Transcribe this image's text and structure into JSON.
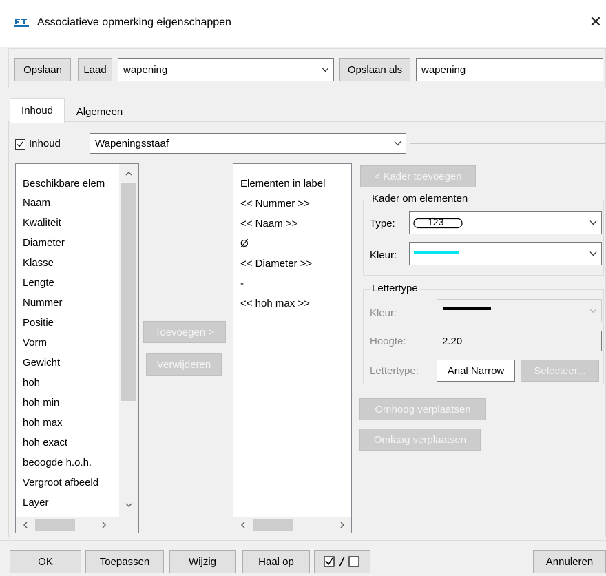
{
  "window": {
    "title": "Associatieve opmerking eigenschappen"
  },
  "toolbar": {
    "save_label": "Opslaan",
    "load_label": "Laad",
    "preset_value": "wapening",
    "save_as_label": "Opslaan als",
    "save_as_value": "wapening"
  },
  "tabs": [
    {
      "label": "Inhoud"
    },
    {
      "label": "Algemeen"
    }
  ],
  "content": {
    "checkbox_label": "Inhoud",
    "type_value": "Wapeningsstaaf"
  },
  "available": {
    "header": "Beschikbare elem",
    "items": [
      "Naam",
      "Kwaliteit",
      "Diameter",
      "Klasse",
      "Lengte",
      "Nummer",
      "Positie",
      "Vorm",
      "Gewicht",
      "hoh",
      "hoh min",
      "hoh max",
      "hoh exact",
      "beoogde h.o.h.",
      "Vergroot afbeeld",
      "Layer"
    ]
  },
  "middle": {
    "add_label": "Toevoegen >",
    "remove_label": "Verwijderen"
  },
  "label_elements": {
    "header": "Elementen in label",
    "items": [
      "<< Nummer >>",
      "<< Naam >>",
      "Ø",
      "<< Diameter >>",
      "-",
      "<< hoh max >>"
    ]
  },
  "frame": {
    "add_frame_label": "< Kader toevoegen",
    "group_title": "Kader om elementen",
    "type_label": "Type:",
    "type_value": "123",
    "color_label": "Kleur:",
    "color_value": "#00e5ee"
  },
  "font": {
    "group_title": "Lettertype",
    "color_label": "Kleur:",
    "color_value": "#000000",
    "height_label": "Hoogte:",
    "height_value": "2.20",
    "font_label": "Lettertype:",
    "font_value": "Arial Narrow",
    "select_label": "Selecteer..."
  },
  "move": {
    "up_label": "Omhoog verplaatsen",
    "down_label": "Omlaag verplaatsen"
  },
  "bottom": {
    "ok_label": "OK",
    "apply_label": "Toepassen",
    "modify_label": "Wijzig",
    "fetch_label": "Haal op",
    "cancel_label": "Annuleren"
  }
}
